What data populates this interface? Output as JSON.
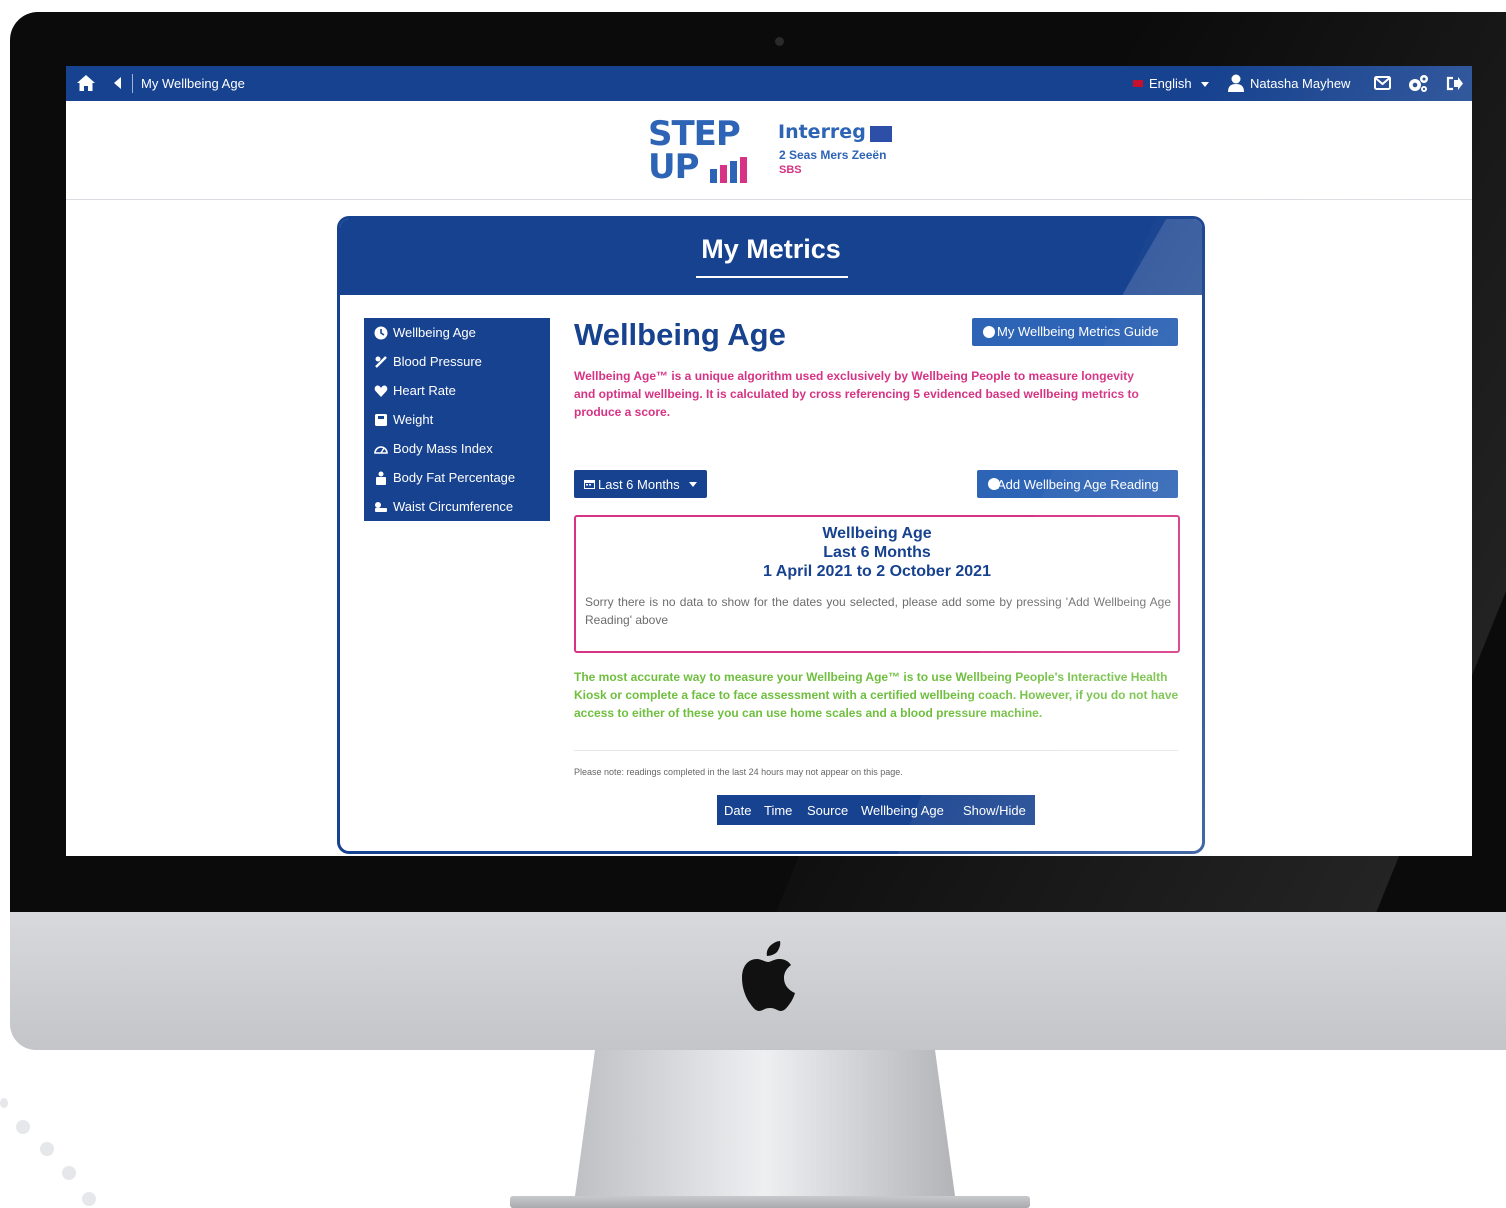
{
  "topbar": {
    "breadcrumb": "My Wellbeing Age",
    "language": "English",
    "user_name": "Natasha Mayhew",
    "icons": [
      "home-icon",
      "back-icon",
      "uk-flag-icon",
      "user-icon",
      "mail-icon",
      "gears-icon",
      "logout-icon"
    ]
  },
  "header": {
    "logo_step_line1": "STEP",
    "logo_step_line2": "UP",
    "logo_interreg": "Interreg",
    "logo_interreg_sub": "2 Seas Mers Zeeën",
    "logo_interreg_tag": "SBS"
  },
  "card": {
    "title": "My Metrics"
  },
  "sidebar": {
    "items": [
      {
        "label": "Wellbeing Age",
        "icon": "wellbeing-age-icon"
      },
      {
        "label": "Blood Pressure",
        "icon": "blood-pressure-icon"
      },
      {
        "label": "Heart Rate",
        "icon": "heart-rate-icon"
      },
      {
        "label": "Weight",
        "icon": "weight-icon"
      },
      {
        "label": "Body Mass Index",
        "icon": "bmi-icon"
      },
      {
        "label": "Body Fat Percentage",
        "icon": "body-fat-icon"
      },
      {
        "label": "Waist Circumference",
        "icon": "waist-icon"
      }
    ]
  },
  "main": {
    "title": "Wellbeing Age",
    "guide_button": "My Wellbeing Metrics Guide",
    "description": "Wellbeing Age™ is a unique algorithm used exclusively by Wellbeing People to measure longevity and optimal wellbeing. It is calculated by cross referencing 5 evidenced based wellbeing metrics to produce a score.",
    "range_button": "Last 6 Months",
    "add_button": "Add Wellbeing Age Reading",
    "panel": {
      "line1": "Wellbeing Age",
      "line2": "Last 6 Months",
      "line3": "1 April 2021 to 2 October 2021",
      "message": "Sorry there is no data to show for the dates you selected, please add some by pressing 'Add Wellbeing Age Reading' above"
    },
    "advice": "The most accurate way to measure your Wellbeing Age™ is to use Wellbeing People's Interactive Health Kiosk or complete a face to face assessment with a certified wellbeing coach. However, if you do not have access to either of these you can use home scales and a blood pressure machine.",
    "note": "Please note: readings completed in the last 24 hours may not appear on this page.",
    "table_headers": [
      "Date",
      "Time",
      "Source",
      "Wellbeing Age",
      "Show/Hide"
    ]
  },
  "colors": {
    "brand_blue": "#17428f",
    "button_blue": "#2e64b5",
    "accent_pink": "#d63384",
    "accent_green": "#6fbf3f"
  }
}
